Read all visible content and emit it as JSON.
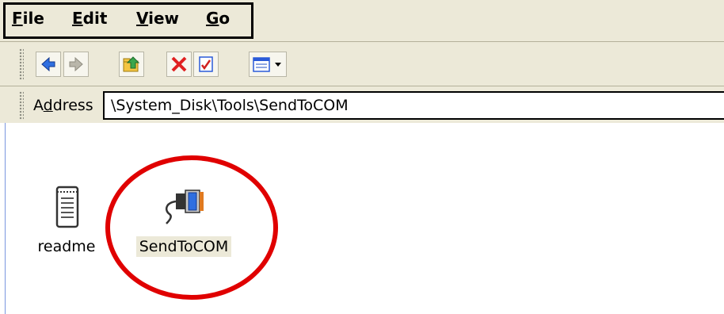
{
  "menu": {
    "file_label": "File",
    "edit_label": "Edit",
    "view_label": "View",
    "go_label": "Go"
  },
  "toolbar": {
    "buttons": [
      "back-icon",
      "forward-icon",
      "up-folder-icon",
      "delete-icon",
      "properties-icon",
      "view-mode-icon"
    ]
  },
  "address": {
    "label": "Address",
    "value": "\\System_Disk\\Tools\\SendToCOM"
  },
  "files": [
    {
      "name": "readme",
      "icon": "text-document-icon",
      "selected": false
    },
    {
      "name": "SendToCOM",
      "icon": "serial-cable-icon",
      "selected": true
    }
  ],
  "annotation": {
    "color": "#e00000"
  }
}
